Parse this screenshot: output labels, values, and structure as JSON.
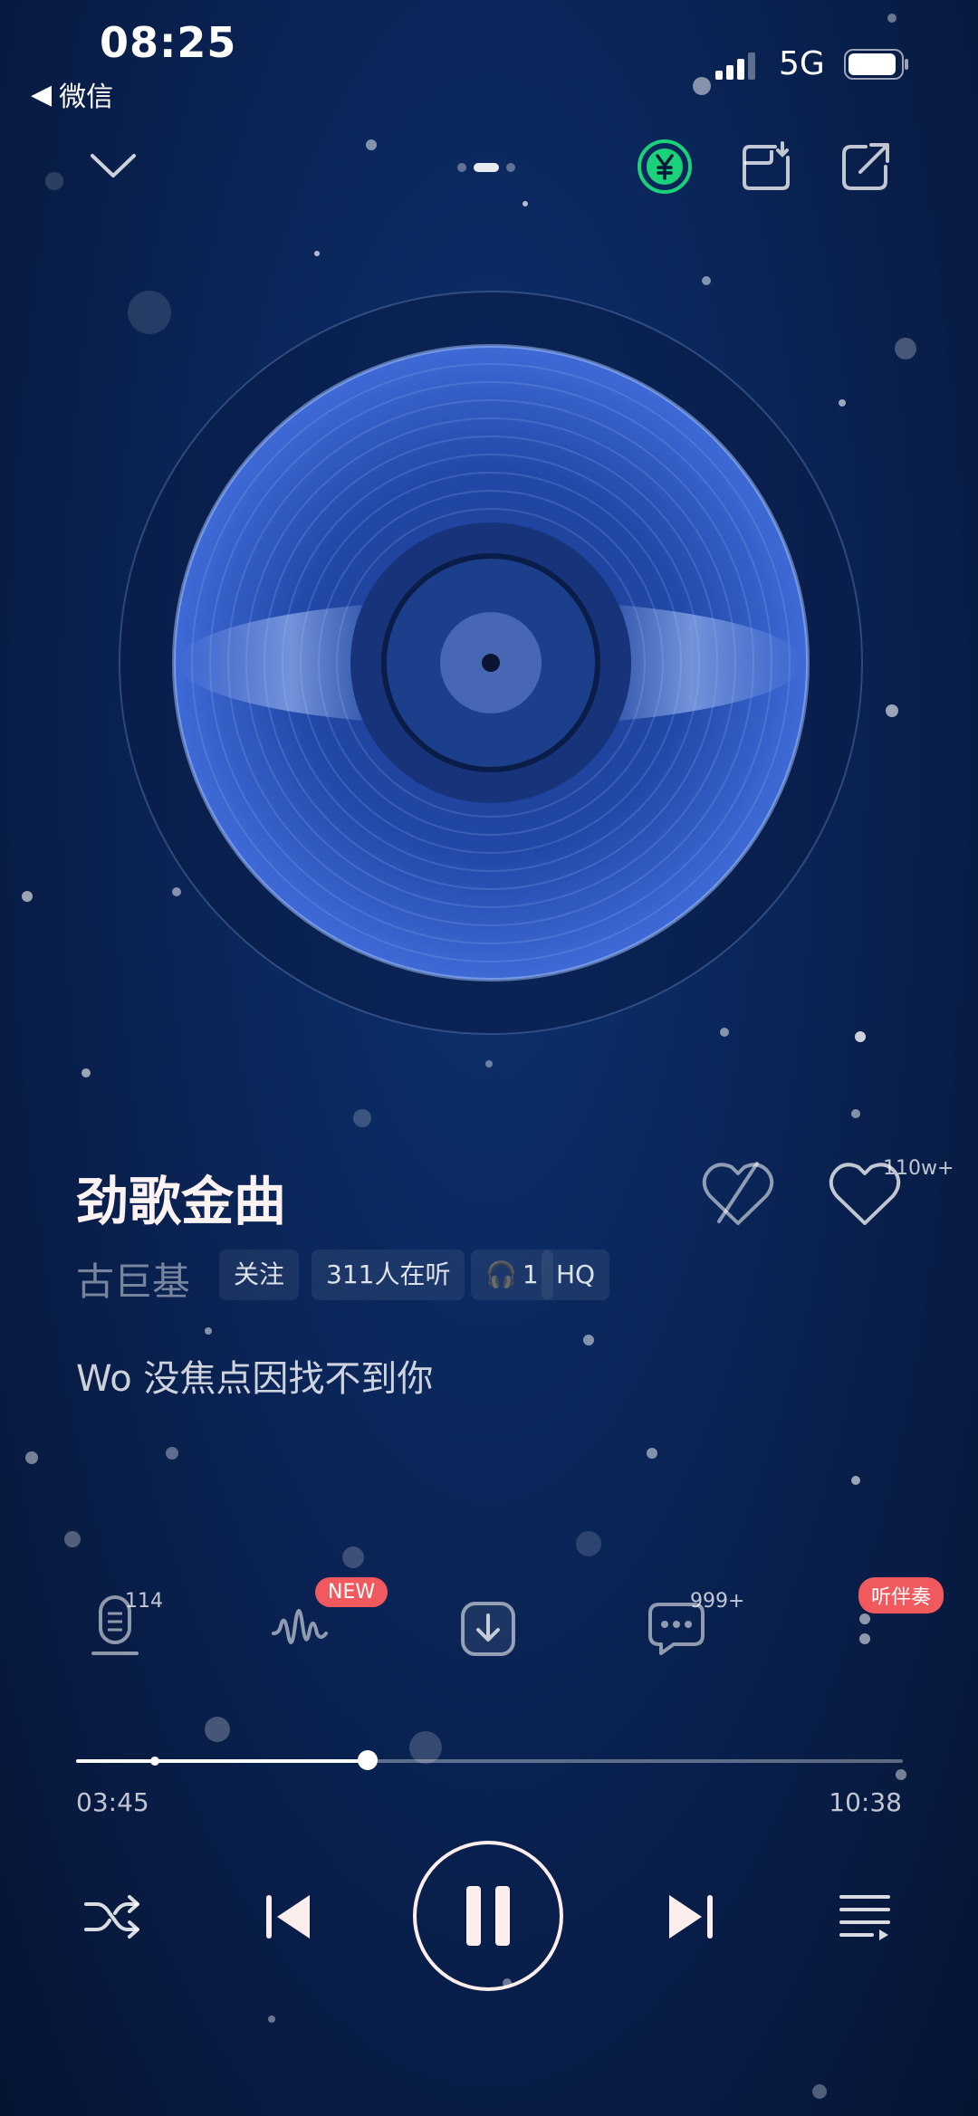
{
  "status_bar": {
    "time": "08:25",
    "back_label": "微信",
    "network": "5G"
  },
  "top_bar": {
    "pager_count": 3,
    "pager_active": 1
  },
  "song": {
    "title": "劲歌金曲",
    "artist": "古巨基",
    "follow_label": "关注",
    "listeners_label": "311人在听",
    "headphone_count": "1",
    "quality": "HQ",
    "like_count": "110w+",
    "lyric": "Wo 没焦点因找不到你"
  },
  "actions": {
    "mic_count": "114",
    "wave_badge": "NEW",
    "comment_count": "999+",
    "more_badge": "听伴奏"
  },
  "progress": {
    "current": "03:45",
    "total": "10:38",
    "fraction": 0.353,
    "marker_fraction": 0.095
  },
  "colors": {
    "accent_green": "#19d27a",
    "badge_red": "#f05a5f",
    "background": "#0a2456"
  },
  "icons": {
    "collapse": "chevron-down-icon",
    "vip": "yen-coin-icon",
    "download_cover": "cover-download-icon",
    "share": "share-icon",
    "dislike": "broken-heart-icon",
    "like": "heart-icon",
    "mic": "microphone-icon",
    "wave": "sound-wave-icon",
    "download": "download-icon",
    "comment": "comment-icon",
    "more": "more-dots-icon",
    "shuffle": "shuffle-icon",
    "prev": "previous-icon",
    "pause": "pause-icon",
    "next": "next-icon",
    "playlist": "playlist-icon"
  }
}
